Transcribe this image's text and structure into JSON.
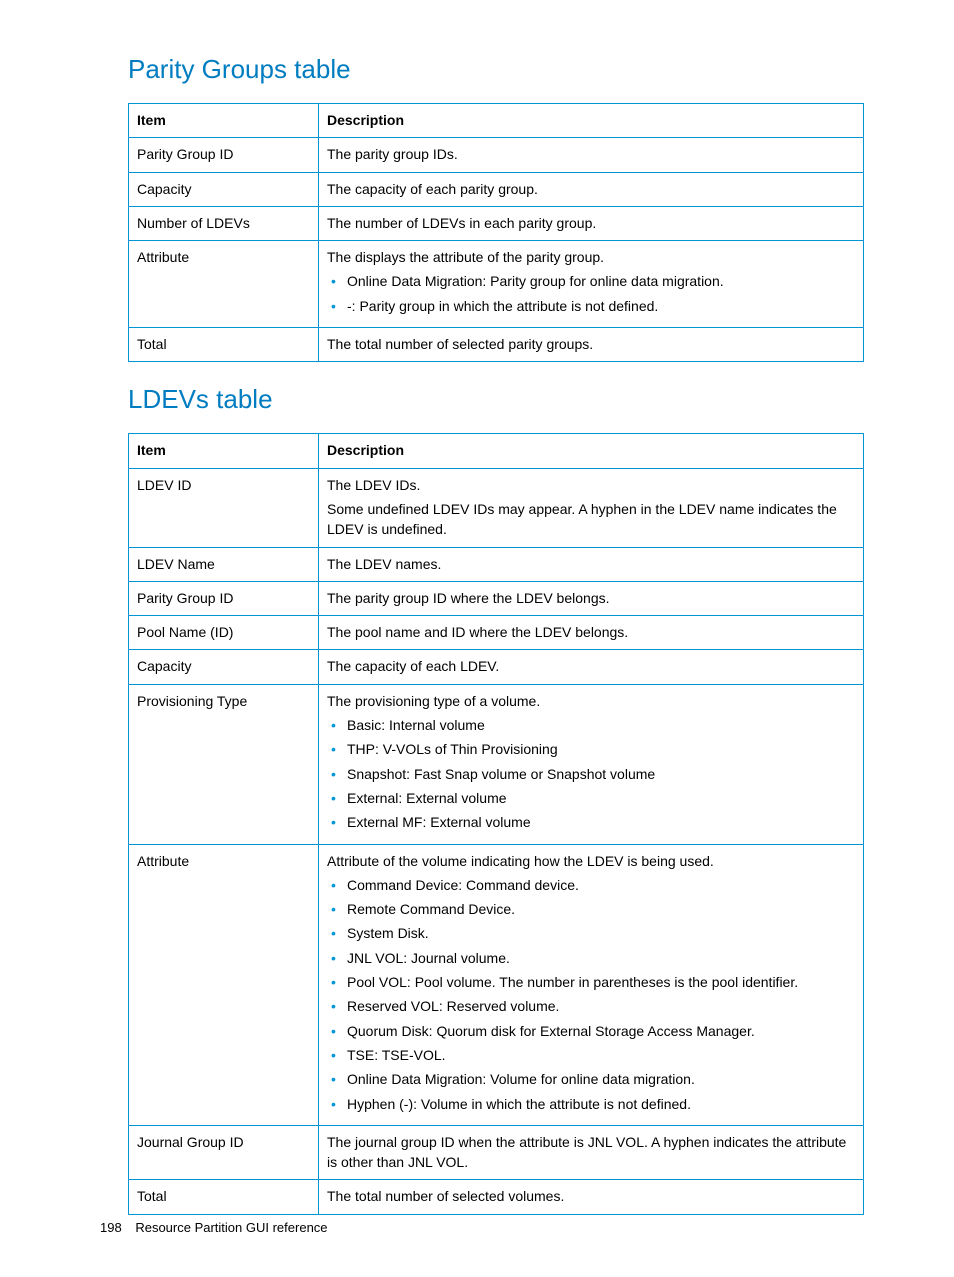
{
  "sections": [
    {
      "title": "Parity Groups table",
      "headers": [
        "Item",
        "Description"
      ],
      "rows": [
        {
          "item": "Parity Group ID",
          "desc": "The parity group IDs."
        },
        {
          "item": "Capacity",
          "desc": "The capacity of each parity group."
        },
        {
          "item": "Number of LDEVs",
          "desc": "The number of LDEVs in each parity group."
        },
        {
          "item": "Attribute",
          "desc": "The displays the attribute of the parity group.",
          "bullets": [
            "Online Data Migration: Parity group for online data migration.",
            "-: Parity group in which the attribute is not defined."
          ]
        },
        {
          "item": "Total",
          "desc": "The total number of selected parity groups."
        }
      ]
    },
    {
      "title": "LDEVs table",
      "headers": [
        "Item",
        "Description"
      ],
      "rows": [
        {
          "item": "LDEV ID",
          "desc": "The LDEV IDs.",
          "extra": "Some undefined LDEV IDs may appear. A hyphen in the LDEV name indicates the LDEV is undefined."
        },
        {
          "item": "LDEV Name",
          "desc": "The LDEV names."
        },
        {
          "item": "Parity Group ID",
          "desc": "The parity group ID where the LDEV belongs."
        },
        {
          "item": "Pool Name (ID)",
          "desc": "The pool name and ID where the LDEV belongs."
        },
        {
          "item": "Capacity",
          "desc": "The capacity of each LDEV."
        },
        {
          "item": "Provisioning Type",
          "desc": "The provisioning type of a volume.",
          "bullets": [
            "Basic: Internal volume",
            "THP: V-VOLs of Thin Provisioning",
            "Snapshot: Fast Snap volume or Snapshot volume",
            "External: External volume",
            "External MF: External volume"
          ]
        },
        {
          "item": "Attribute",
          "desc": "Attribute of the volume indicating how the LDEV is being used.",
          "bullets": [
            "Command Device: Command device.",
            "Remote Command Device.",
            "System Disk.",
            "JNL VOL: Journal volume.",
            "Pool VOL: Pool volume. The number in parentheses is the pool identifier.",
            "Reserved VOL: Reserved volume.",
            "Quorum Disk: Quorum disk for External Storage Access Manager.",
            "TSE: TSE-VOL.",
            "Online Data Migration: Volume for online data migration.",
            "Hyphen (-): Volume in which the attribute is not defined."
          ]
        },
        {
          "item": "Journal Group ID",
          "desc": "The journal group ID when the attribute is JNL VOL. A hyphen indicates the attribute is other than JNL VOL."
        },
        {
          "item": "Total",
          "desc": "The total number of selected volumes."
        }
      ]
    }
  ],
  "footer": {
    "page_number": "198",
    "label": "Resource Partition GUI reference"
  }
}
